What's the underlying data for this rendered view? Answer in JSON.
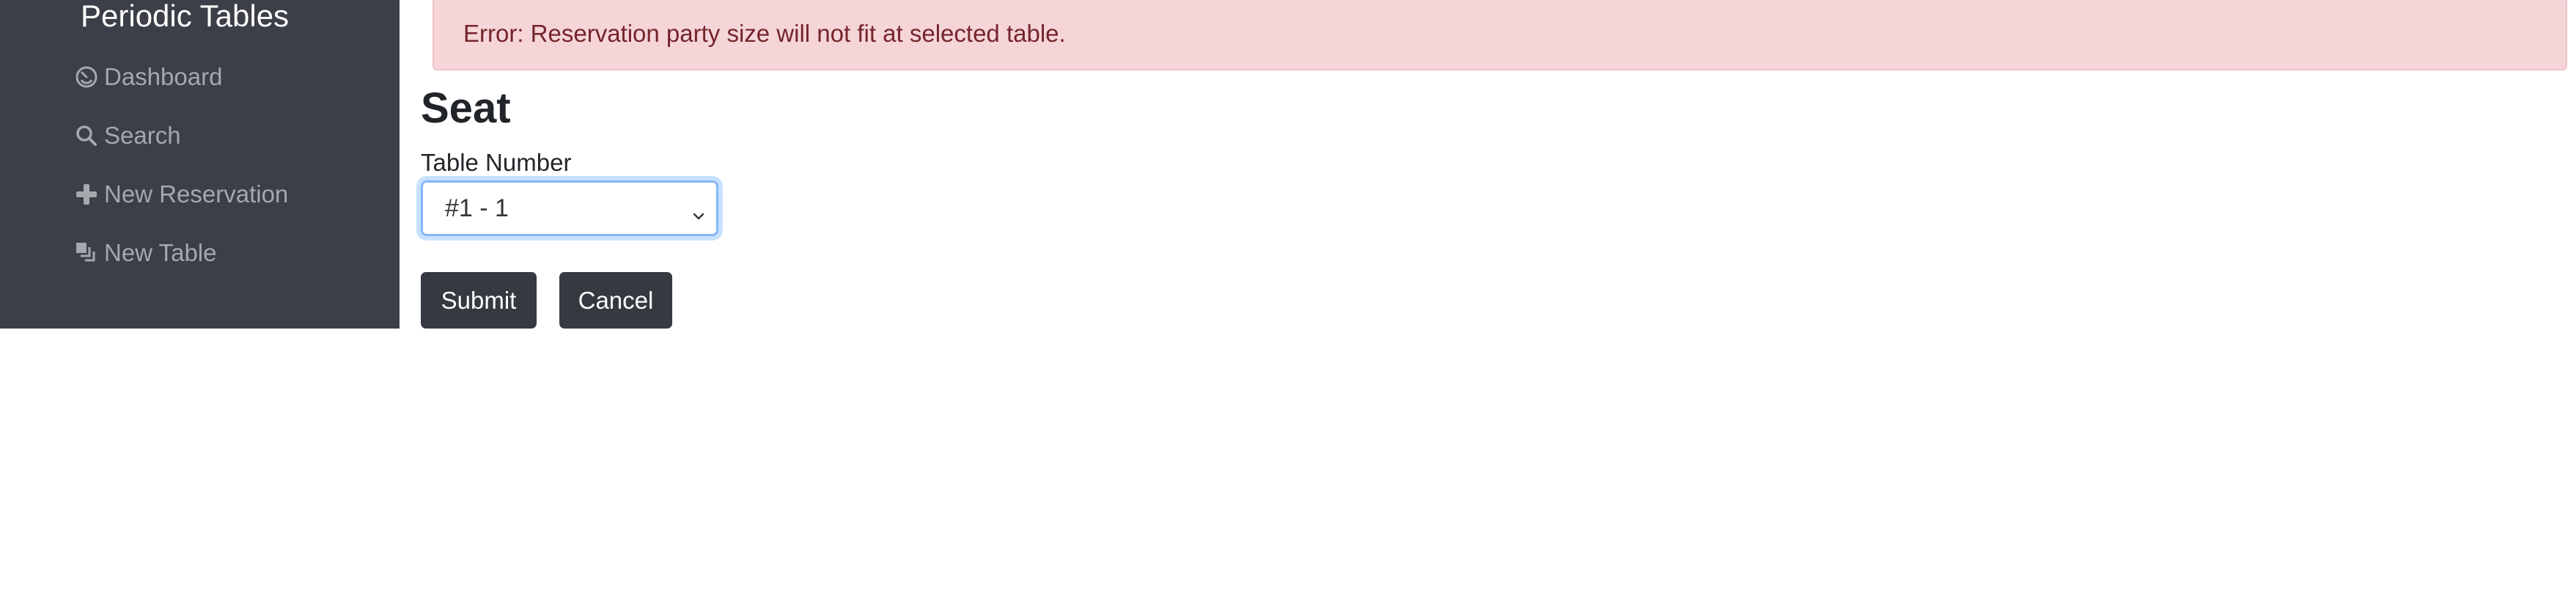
{
  "sidebar": {
    "brand": "Periodic Tables",
    "items": [
      {
        "label": "Dashboard",
        "icon": "dashboard-icon"
      },
      {
        "label": "Search",
        "icon": "search-icon"
      },
      {
        "label": "New Reservation",
        "icon": "plus-icon"
      },
      {
        "label": "New Table",
        "icon": "layers-icon"
      }
    ]
  },
  "alert": {
    "message": "Error: Reservation party size will not fit at selected table."
  },
  "main": {
    "title": "Seat",
    "table_label": "Table Number",
    "table_selected": "#1 - 1",
    "submit_label": "Submit",
    "cancel_label": "Cancel"
  },
  "colors": {
    "sidebar_bg": "#3c3e48",
    "alert_bg": "#f5d5d8",
    "alert_text": "#75242b",
    "button_bg": "#343a40",
    "focus_ring": "#87b6f7"
  }
}
